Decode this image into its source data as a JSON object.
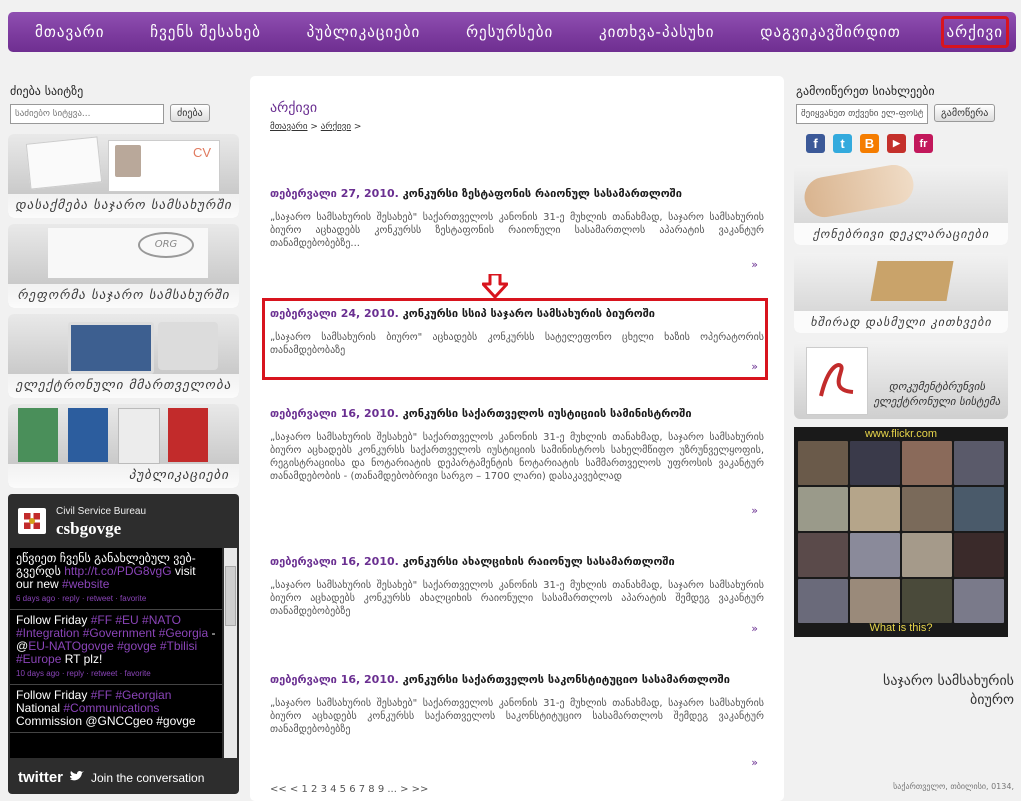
{
  "nav": {
    "items": [
      "მთავარი",
      "ჩვენს შესახებ",
      "პუბლიკაციები",
      "რესურსები",
      "კითხვა-პასუხი",
      "დაგვიკავშირდით",
      "არქივი"
    ],
    "active_index": 6
  },
  "search": {
    "title": "ძიება საიტზე",
    "placeholder": "საძიებო სიტყვა...",
    "button": "ძიება"
  },
  "left_banners": [
    {
      "caption": "დასაქმება საჯარო სამსახურში",
      "thumb_label": "CV"
    },
    {
      "caption": "რეფორმა საჯარო სამსახურში",
      "thumb_label": "ORG"
    },
    {
      "caption": "ელექტრონული მმართველობა"
    },
    {
      "caption": "პუბლიკაციები"
    }
  ],
  "twitter": {
    "account_name": "Civil Service Bureau",
    "handle": "csbgovge",
    "tweets": [
      {
        "text": "ეწვიეთ ჩვენს განახლებულ ვებ-გვერდს ",
        "link": "http://t.co/PDG8vgG",
        "text2": " visit our new ",
        "tag": "#website",
        "meta": "6 days ago · reply · retweet · favorite"
      },
      {
        "text": "Follow Friday ",
        "link": "#FF #EU #NATO #Integration #Government #Georgia",
        "text2": " - @",
        "tag": "EU-NATOgovge #govge #Tbilisi #Europe",
        "text3": " RT plz!",
        "meta": "10 days ago · reply · retweet · favorite"
      },
      {
        "text": "Follow Friday ",
        "link": "#FF #Georgian",
        "text2": " National ",
        "tag": "#Communications",
        "text3": " Commission @GNCCgeo #govge",
        "meta": ""
      }
    ],
    "footer_brand": "twitter",
    "footer_text": "Join the conversation"
  },
  "page": {
    "title": "არქივი",
    "breadcrumb": [
      "მთავარი",
      "არქივი"
    ],
    "breadcrumb_sep": " > ",
    "breadcrumb_tail": " >"
  },
  "articles": [
    {
      "date": "თებერვალი 27, 2010.",
      "title": " კონკურსი ზესტაფონის რაიონულ სასამართლოში",
      "body": "„საჯარო სამსახურის შესახებ\" საქართველოს კანონის 31-ე მუხლის თანახმად, საჯარო სამსახურის ბიურო აცხადებს კონკურსს ზესტაფონის რაიონული სასამართლოს აპარატის ვაკანტურ თანამდებობებზე...",
      "more": "»"
    },
    {
      "date": "თებერვალი 24, 2010.",
      "title": " კონკურსი სსიპ საჯარო სამსახურის ბიუროში",
      "body": "„საჯარო სამსახურის ბიურო\" აცხადებს კონკურსს სატელეფონო ცხელი ხაზის ოპერატორის თანამდებობაზე",
      "more": "»"
    },
    {
      "date": "თებერვალი 16, 2010.",
      "title": " კონკურსი საქართველოს იუსტიციის სამინისტროში",
      "body": "„საჯარო სამსახურის შესახებ\" საქართველოს კანონის 31-ე მუხლის თანახმად, საჯარო სამსახურის ბიურო აცხადებს კონკურსს საქართველოს იუსტიციის სამინისტროს სახელმწიფო უზრუნველყოფის, რეგისტრაციისა და ნოტარიატის დეპარტამენტის ნოტარიატის სამმართველოს უფროსის ვაკანტურ თანამდებობის - (თანამდებობრივი სარგო – 1700 ლარი) დასაკავებლად",
      "more": "»"
    },
    {
      "date": "თებერვალი 16, 2010.",
      "title": " კონკურსი ახალციხის რაიონულ სასამართლოში",
      "body": "„საჯარო სამსახურის შესახებ\" საქართველოს კანონის 31-ე მუხლის თანახმად, საჯარო სამსახურის ბიურო აცხადებს კონკურსს ახალციხის რაიონული სასამართლოს აპარატის შემდეგ ვაკანტურ თანამდებობებზე",
      "more": "»"
    },
    {
      "date": "თებერვალი 16, 2010.",
      "title": " კონკურსი საქართველოს საკონსტიტუციო სასამართლოში",
      "body": "„საჯარო სამსახურის შესახებ\" საქართველოს კანონის 31-ე მუხლის თანახმად, საჯარო სამსახურის ბიურო აცხადებს კონკურსს საქართველოს საკონსტიტუციო სასამართლოს შემდეგ ვაკანტურ თანამდებობებზე",
      "more": "»"
    }
  ],
  "pagination": "<< < 1 2 3 4 5 6 7 8 9 ... > >>",
  "share": {
    "title": "გამოიწერეთ სიახლეები",
    "input_value": "შეიყვანეთ თქვენი ელ-ფოსტა",
    "button": "გამოწერა",
    "icons": [
      {
        "name": "facebook-icon",
        "glyph": "f",
        "color": "#3b5998"
      },
      {
        "name": "twitter-icon",
        "glyph": "t",
        "color": "#33aadd"
      },
      {
        "name": "blogger-icon",
        "glyph": "B",
        "color": "#f57d00"
      },
      {
        "name": "youtube-icon",
        "glyph": "▶",
        "color": "#c4302b"
      },
      {
        "name": "friendfeed-icon",
        "glyph": "fr",
        "color": "#c2185b"
      }
    ]
  },
  "right_banners": [
    {
      "caption": "ქონებრივი დეკლარაციები"
    },
    {
      "caption": "ხშირად დასმული კითხვები"
    },
    {
      "caption": "დოკუმენტბრუნვის ელექტრონული სისტემა"
    }
  ],
  "flickr": {
    "logo": "www.flickr.com",
    "footer": "What is this?"
  },
  "org": {
    "name": "საჯარო სამსახურის ბიურო",
    "address": "საქართველო, თბილისი, 0134,"
  },
  "colors": {
    "purple": "#7b3a9d",
    "highlight_red": "#d8141e"
  }
}
